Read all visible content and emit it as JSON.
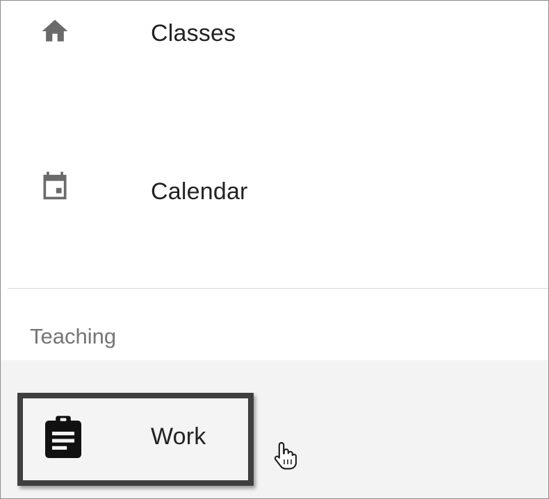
{
  "nav": {
    "items": [
      {
        "label": "Classes",
        "icon": "home-icon"
      },
      {
        "label": "Calendar",
        "icon": "calendar-icon"
      }
    ]
  },
  "teaching_section": {
    "header": "Teaching",
    "items": [
      {
        "label": "Work",
        "icon": "assignment-icon",
        "selected": true
      }
    ]
  },
  "colors": {
    "icon_gray": "#6a6a6a",
    "text": "#222222",
    "section_header": "#757575",
    "selected_band": "#f3f3f3",
    "highlight_border": "#3f3f3f"
  }
}
